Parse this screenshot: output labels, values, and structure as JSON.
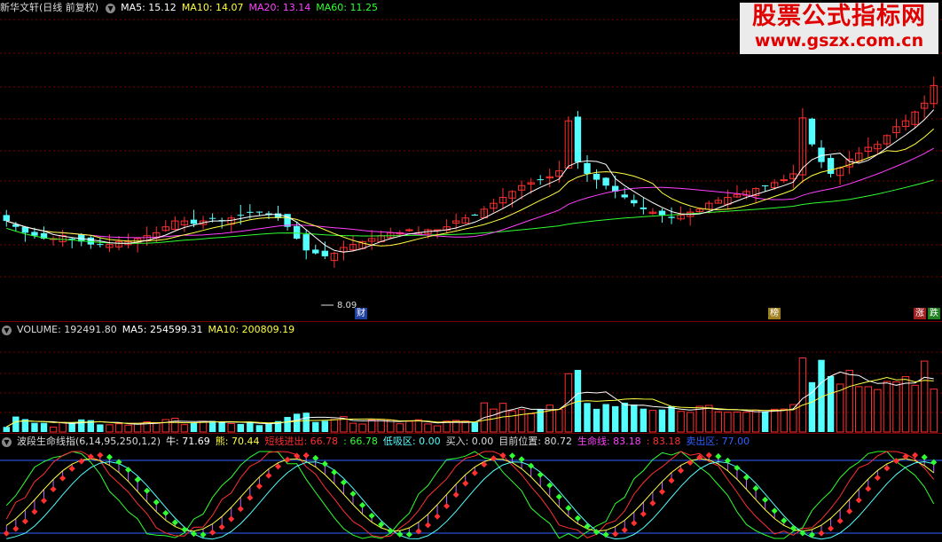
{
  "price_header": {
    "title": "新华文轩(日线 前复权)",
    "ma5": "MA5: 15.12",
    "ma10": "MA10: 14.07",
    "ma20": "MA20: 13.14",
    "ma60": "MA60: 11.25"
  },
  "colors": {
    "up": "#ff3030",
    "down": "#54ffff",
    "ma5": "#ffffff",
    "ma10": "#ffff40",
    "ma20": "#ff40ff",
    "ma60": "#30ff30",
    "grid": "#7a0000"
  },
  "watermark": {
    "line1": "股票公式指标网",
    "line2": "www.gszx.com.cn"
  },
  "price_annotations": {
    "low_label": "8.09",
    "tag_cai": "财",
    "tag_bang": "榜",
    "tag_zhang": "涨",
    "tag_die": "跌"
  },
  "volume_header": {
    "title": "VOLUME: 192491.80",
    "ma5": "MA5: 254599.31",
    "ma10": "MA10: 200809.19"
  },
  "indicator_header": {
    "title": "波段生命线指(6,14,95,250,1,2)",
    "niu": "牛: 71.69",
    "xiong": "熊: 70.44",
    "duanxian": "短线进出: 66.78",
    "blank": ": 66.78",
    "dixiqu": "低吸区: 0.00",
    "mairu": "买入: 0.00",
    "mubiao": "目前位置: 80.72",
    "shengming": "生命线: 83.18",
    "shengming2": ": 83.18",
    "maichu": "卖出区: 77.00"
  },
  "chart_data": {
    "type": "candlestick",
    "price_range": [
      7.5,
      17.5
    ],
    "prices_close_approx": [
      10.6,
      10.4,
      10.2,
      10.1,
      10.0,
      10.0,
      10.1,
      10.0,
      9.9,
      9.8,
      9.8,
      9.8,
      9.9,
      9.9,
      10.0,
      10.1,
      10.2,
      10.4,
      10.6,
      10.6,
      10.5,
      10.6,
      10.7,
      10.6,
      10.7,
      10.8,
      10.9,
      10.9,
      10.8,
      10.7,
      10.4,
      10.0,
      9.6,
      9.5,
      9.4,
      9.5,
      9.7,
      9.8,
      9.9,
      10.0,
      10.1,
      10.2,
      10.2,
      10.3,
      10.2,
      10.3,
      10.3,
      10.4,
      10.6,
      10.7,
      10.8,
      11.0,
      11.2,
      11.4,
      11.6,
      11.8,
      11.9,
      12.0,
      12.1,
      12.3,
      14.0,
      12.6,
      12.2,
      12.0,
      11.8,
      11.6,
      11.4,
      11.2,
      11.0,
      10.9,
      10.8,
      10.7,
      10.8,
      10.9,
      11.0,
      11.2,
      11.3,
      11.4,
      11.5,
      11.6,
      11.7,
      11.8,
      11.9,
      12.0,
      12.2,
      14.1,
      13.2,
      12.6,
      12.2,
      12.4,
      12.7,
      12.9,
      13.1,
      13.2,
      13.5,
      13.8,
      14.0,
      14.3,
      14.6,
      15.2
    ],
    "volume_range": [
      0,
      800000
    ],
    "indicator_range": [
      0,
      100
    ]
  }
}
